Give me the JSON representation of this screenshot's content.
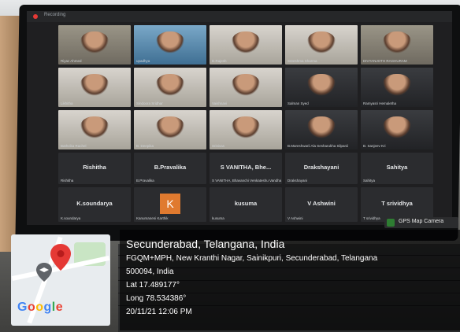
{
  "meeting": {
    "top_bar_text": "Recording",
    "tiles": [
      {
        "row": 0,
        "col": 0,
        "name": "Riyaz Ahmed",
        "style": "room"
      },
      {
        "row": 0,
        "col": 1,
        "name": "upadhya",
        "style": "blue"
      },
      {
        "row": 0,
        "col": 2,
        "name": "D.Rajesh",
        "style": "light"
      },
      {
        "row": 0,
        "col": 3,
        "name": "Sreeshma Sharma",
        "style": "light"
      },
      {
        "row": 0,
        "col": 4,
        "name": "DIVYANJOTH RAGHURAM",
        "style": "room"
      },
      {
        "row": 1,
        "col": 0,
        "name": "Likhitha",
        "style": "light"
      },
      {
        "row": 1,
        "col": 1,
        "name": "Sindoora Sridhar",
        "style": "light"
      },
      {
        "row": 1,
        "col": 2,
        "name": "Vaishnavi",
        "style": "light"
      },
      {
        "row": 1,
        "col": 3,
        "name": "Salman Syed",
        "style": "dark"
      },
      {
        "row": 1,
        "col": 4,
        "name": "Ramyasri Hemaletha",
        "style": "dark"
      },
      {
        "row": 2,
        "col": 0,
        "name": "Bathvika Rachel",
        "style": "light"
      },
      {
        "row": 2,
        "col": 1,
        "name": "B. Deepika",
        "style": "light"
      },
      {
        "row": 2,
        "col": 2,
        "name": "Srinivas",
        "style": "light"
      },
      {
        "row": 2,
        "col": 3,
        "name": "B.Mareshwarii Ala Sesharukha Silpanii",
        "style": "dark"
      },
      {
        "row": 2,
        "col": 4,
        "name": "B. Sanjeev Kri",
        "style": "dark"
      }
    ],
    "name_tiles": [
      {
        "big": "Rishitha",
        "label": "Rishitha"
      },
      {
        "big": "B.Pravalika",
        "label": "B.Pravalika"
      },
      {
        "big": "S VANITHA, Bhe...",
        "label": "S VANITHA, Bhavanchi Venkateshu Vandha"
      },
      {
        "big": "Drakshayani",
        "label": "Drakshayani"
      },
      {
        "big": "Sahitya",
        "label": "Sahitya"
      }
    ],
    "bottom_tiles": [
      {
        "big": "K.soundarya",
        "label": "K.soundarya"
      },
      {
        "big": "",
        "label": "Kanumaneni Karthik",
        "letter": "K"
      },
      {
        "big": "kusuma",
        "label": "kusuma"
      },
      {
        "big": "V Ashwini",
        "label": "V Ashwini"
      },
      {
        "big": "T srividhya",
        "label": "T srividhya"
      }
    ]
  },
  "gps_badge": {
    "label": "GPS Map Camera"
  },
  "location": {
    "title": "Secunderabad, Telangana, India",
    "address_line1": "FGQM+MPH, New Kranthi Nagar, Sainikpuri, Secunderabad, Telangana",
    "address_line2": "500094, India",
    "latitude": "Lat 17.489177°",
    "longitude": "Long 78.534386°",
    "datetime": "20/11/21 12:06 PM"
  },
  "map": {
    "brand": "Google"
  },
  "colors": {
    "pin_red": "#e53935",
    "google_blue": "#4285f4",
    "google_red": "#ea4335",
    "google_yellow": "#fbbc05",
    "google_green": "#34a853"
  }
}
